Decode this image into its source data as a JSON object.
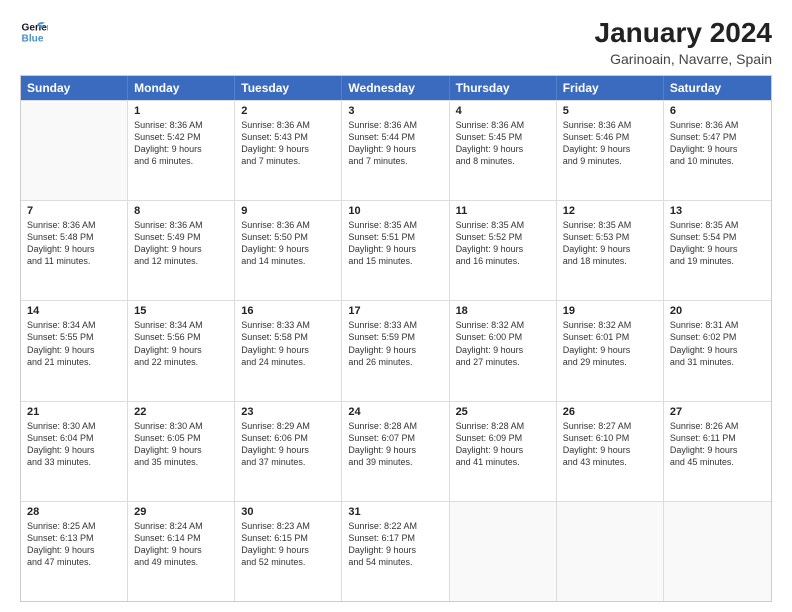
{
  "logo": {
    "line1": "General",
    "line2": "Blue"
  },
  "title": "January 2024",
  "subtitle": "Garinoain, Navarre, Spain",
  "columns": [
    "Sunday",
    "Monday",
    "Tuesday",
    "Wednesday",
    "Thursday",
    "Friday",
    "Saturday"
  ],
  "weeks": [
    [
      {
        "day": "",
        "info": ""
      },
      {
        "day": "1",
        "info": "Sunrise: 8:36 AM\nSunset: 5:42 PM\nDaylight: 9 hours\nand 6 minutes."
      },
      {
        "day": "2",
        "info": "Sunrise: 8:36 AM\nSunset: 5:43 PM\nDaylight: 9 hours\nand 7 minutes."
      },
      {
        "day": "3",
        "info": "Sunrise: 8:36 AM\nSunset: 5:44 PM\nDaylight: 9 hours\nand 7 minutes."
      },
      {
        "day": "4",
        "info": "Sunrise: 8:36 AM\nSunset: 5:45 PM\nDaylight: 9 hours\nand 8 minutes."
      },
      {
        "day": "5",
        "info": "Sunrise: 8:36 AM\nSunset: 5:46 PM\nDaylight: 9 hours\nand 9 minutes."
      },
      {
        "day": "6",
        "info": "Sunrise: 8:36 AM\nSunset: 5:47 PM\nDaylight: 9 hours\nand 10 minutes."
      }
    ],
    [
      {
        "day": "7",
        "info": "Sunrise: 8:36 AM\nSunset: 5:48 PM\nDaylight: 9 hours\nand 11 minutes."
      },
      {
        "day": "8",
        "info": "Sunrise: 8:36 AM\nSunset: 5:49 PM\nDaylight: 9 hours\nand 12 minutes."
      },
      {
        "day": "9",
        "info": "Sunrise: 8:36 AM\nSunset: 5:50 PM\nDaylight: 9 hours\nand 14 minutes."
      },
      {
        "day": "10",
        "info": "Sunrise: 8:35 AM\nSunset: 5:51 PM\nDaylight: 9 hours\nand 15 minutes."
      },
      {
        "day": "11",
        "info": "Sunrise: 8:35 AM\nSunset: 5:52 PM\nDaylight: 9 hours\nand 16 minutes."
      },
      {
        "day": "12",
        "info": "Sunrise: 8:35 AM\nSunset: 5:53 PM\nDaylight: 9 hours\nand 18 minutes."
      },
      {
        "day": "13",
        "info": "Sunrise: 8:35 AM\nSunset: 5:54 PM\nDaylight: 9 hours\nand 19 minutes."
      }
    ],
    [
      {
        "day": "14",
        "info": "Sunrise: 8:34 AM\nSunset: 5:55 PM\nDaylight: 9 hours\nand 21 minutes."
      },
      {
        "day": "15",
        "info": "Sunrise: 8:34 AM\nSunset: 5:56 PM\nDaylight: 9 hours\nand 22 minutes."
      },
      {
        "day": "16",
        "info": "Sunrise: 8:33 AM\nSunset: 5:58 PM\nDaylight: 9 hours\nand 24 minutes."
      },
      {
        "day": "17",
        "info": "Sunrise: 8:33 AM\nSunset: 5:59 PM\nDaylight: 9 hours\nand 26 minutes."
      },
      {
        "day": "18",
        "info": "Sunrise: 8:32 AM\nSunset: 6:00 PM\nDaylight: 9 hours\nand 27 minutes."
      },
      {
        "day": "19",
        "info": "Sunrise: 8:32 AM\nSunset: 6:01 PM\nDaylight: 9 hours\nand 29 minutes."
      },
      {
        "day": "20",
        "info": "Sunrise: 8:31 AM\nSunset: 6:02 PM\nDaylight: 9 hours\nand 31 minutes."
      }
    ],
    [
      {
        "day": "21",
        "info": "Sunrise: 8:30 AM\nSunset: 6:04 PM\nDaylight: 9 hours\nand 33 minutes."
      },
      {
        "day": "22",
        "info": "Sunrise: 8:30 AM\nSunset: 6:05 PM\nDaylight: 9 hours\nand 35 minutes."
      },
      {
        "day": "23",
        "info": "Sunrise: 8:29 AM\nSunset: 6:06 PM\nDaylight: 9 hours\nand 37 minutes."
      },
      {
        "day": "24",
        "info": "Sunrise: 8:28 AM\nSunset: 6:07 PM\nDaylight: 9 hours\nand 39 minutes."
      },
      {
        "day": "25",
        "info": "Sunrise: 8:28 AM\nSunset: 6:09 PM\nDaylight: 9 hours\nand 41 minutes."
      },
      {
        "day": "26",
        "info": "Sunrise: 8:27 AM\nSunset: 6:10 PM\nDaylight: 9 hours\nand 43 minutes."
      },
      {
        "day": "27",
        "info": "Sunrise: 8:26 AM\nSunset: 6:11 PM\nDaylight: 9 hours\nand 45 minutes."
      }
    ],
    [
      {
        "day": "28",
        "info": "Sunrise: 8:25 AM\nSunset: 6:13 PM\nDaylight: 9 hours\nand 47 minutes."
      },
      {
        "day": "29",
        "info": "Sunrise: 8:24 AM\nSunset: 6:14 PM\nDaylight: 9 hours\nand 49 minutes."
      },
      {
        "day": "30",
        "info": "Sunrise: 8:23 AM\nSunset: 6:15 PM\nDaylight: 9 hours\nand 52 minutes."
      },
      {
        "day": "31",
        "info": "Sunrise: 8:22 AM\nSunset: 6:17 PM\nDaylight: 9 hours\nand 54 minutes."
      },
      {
        "day": "",
        "info": ""
      },
      {
        "day": "",
        "info": ""
      },
      {
        "day": "",
        "info": ""
      }
    ]
  ]
}
